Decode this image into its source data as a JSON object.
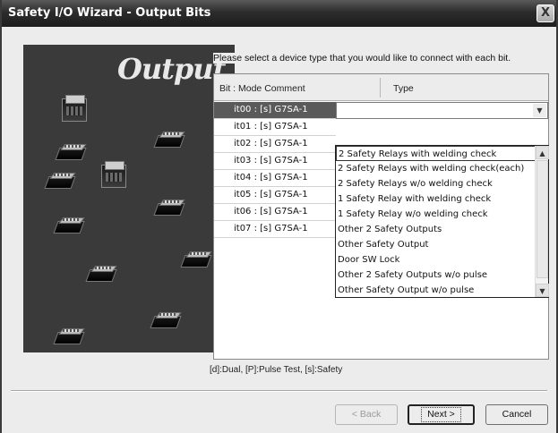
{
  "window": {
    "title": "Safety I/O Wizard - Output Bits",
    "close_glyph": "X"
  },
  "graphic": {
    "title": "Output"
  },
  "prompt": "Please select a device type that you would like to connect with each bit.",
  "table": {
    "headers": {
      "bit": "Bit : Mode Comment",
      "type": "Type"
    },
    "rows": [
      "it00 : [s] G7SA-1",
      "it01 : [s] G7SA-1",
      "it02 : [s] G7SA-1",
      "it03 : [s] G7SA-1",
      "it04 : [s] G7SA-1",
      "it05 : [s] G7SA-1",
      "it06 : [s] G7SA-1",
      "it07 : [s] G7SA-1"
    ],
    "selected_row_index": 0,
    "type_value": ""
  },
  "dropdown": {
    "options": [
      "2 Safety Relays with welding check",
      "2 Safety Relays with welding check(each)",
      "2 Safety Relays w/o welding check",
      "1 Safety Relay with welding check",
      "1 Safety Relay w/o welding check",
      "Other 2 Safety Outputs",
      "Other Safety Output",
      "Door SW Lock",
      "Other 2 Safety Outputs w/o pulse",
      "Other Safety Output w/o pulse"
    ],
    "highlighted_index": 0
  },
  "legend": "[d]:Dual, [P]:Pulse Test, [s]:Safety",
  "buttons": {
    "back": "< Back",
    "next": "Next >",
    "cancel": "Cancel"
  },
  "icons": {
    "close": "close-icon",
    "combo_arrow": "chevron-down-icon",
    "scroll_up": "chevron-up-icon",
    "scroll_down": "chevron-down-icon"
  }
}
